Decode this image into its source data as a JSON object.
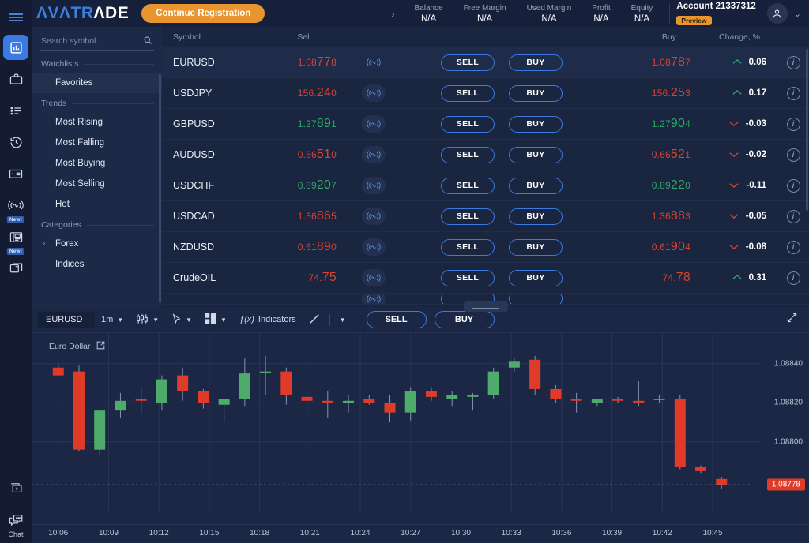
{
  "rail": {
    "menu_label": "menu",
    "items": [
      {
        "name": "trading",
        "icon": "chart-bars-icon",
        "active": true
      },
      {
        "name": "portfolio",
        "icon": "briefcase-icon",
        "active": false
      },
      {
        "name": "orders",
        "icon": "list-icon",
        "active": false
      },
      {
        "name": "history",
        "icon": "history-clock-icon",
        "active": false
      },
      {
        "name": "funds",
        "icon": "card-icon",
        "active": false
      },
      {
        "name": "signals",
        "icon": "signal-wave-icon",
        "active": false,
        "badge": "New!"
      },
      {
        "name": "news",
        "icon": "newspaper-icon",
        "active": false,
        "badge": "New!"
      },
      {
        "name": "windows",
        "icon": "window-icon",
        "active": false
      }
    ],
    "bottom": [
      {
        "name": "video",
        "icon": "video-play-icon"
      },
      {
        "name": "chat",
        "icon": "chat-bubble-icon",
        "label": "Chat"
      }
    ]
  },
  "header": {
    "logo_a": "ΛVΛTR",
    "logo_b": "ΛDE",
    "cta_label": "Continue Registration",
    "expand_chevron": "›",
    "metrics": [
      {
        "label": "Balance",
        "value": "N/A"
      },
      {
        "label": "Free Margin",
        "value": "N/A"
      },
      {
        "label": "Used Margin",
        "value": "N/A"
      },
      {
        "label": "Profit",
        "value": "N/A"
      },
      {
        "label": "Equity",
        "value": "N/A"
      }
    ],
    "account_name": "Account 21337312",
    "account_badge": "Preview",
    "dropdown_caret": "⌄"
  },
  "watchlist": {
    "search_placeholder": "Search symbol...",
    "groups": [
      {
        "title": "Watchlists",
        "items": [
          {
            "label": "Favorites",
            "selected": true
          }
        ]
      },
      {
        "title": "Trends",
        "items": [
          {
            "label": "Most Rising"
          },
          {
            "label": "Most Falling"
          },
          {
            "label": "Most Buying"
          },
          {
            "label": "Most Selling"
          },
          {
            "label": "Hot"
          }
        ]
      },
      {
        "title": "Categories",
        "items": [
          {
            "label": "Forex",
            "caret": "›"
          },
          {
            "label": "Indices"
          }
        ]
      }
    ]
  },
  "table": {
    "columns": {
      "symbol": "Symbol",
      "sell": "Sell",
      "buy": "Buy",
      "change": "Change, %"
    },
    "sell_label": "SELL",
    "buy_label": "BUY",
    "rows": [
      {
        "symbol": "EURUSD",
        "sell_pre": "1.08",
        "sell_big": "77",
        "sell_post": "8",
        "sell_dir": "dn",
        "buy_pre": "1.08",
        "buy_big": "78",
        "buy_post": "7",
        "buy_dir": "dn",
        "change": "0.06",
        "change_dir": "up",
        "highlight": true
      },
      {
        "symbol": "USDJPY",
        "sell_pre": "156.",
        "sell_big": "24",
        "sell_post": "0",
        "sell_dir": "dn",
        "buy_pre": "156.",
        "buy_big": "25",
        "buy_post": "3",
        "buy_dir": "dn",
        "change": "0.17",
        "change_dir": "up"
      },
      {
        "symbol": "GBPUSD",
        "sell_pre": "1.27",
        "sell_big": "89",
        "sell_post": "1",
        "sell_dir": "up",
        "buy_pre": "1.27",
        "buy_big": "90",
        "buy_post": "4",
        "buy_dir": "up",
        "change": "-0.03",
        "change_dir": "dn"
      },
      {
        "symbol": "AUDUSD",
        "sell_pre": "0.66",
        "sell_big": "51",
        "sell_post": "0",
        "sell_dir": "dn",
        "buy_pre": "0.66",
        "buy_big": "52",
        "buy_post": "1",
        "buy_dir": "dn",
        "change": "-0.02",
        "change_dir": "dn"
      },
      {
        "symbol": "USDCHF",
        "sell_pre": "0.89",
        "sell_big": "20",
        "sell_post": "7",
        "sell_dir": "up",
        "buy_pre": "0.89",
        "buy_big": "22",
        "buy_post": "0",
        "buy_dir": "up",
        "change": "-0.11",
        "change_dir": "dn"
      },
      {
        "symbol": "USDCAD",
        "sell_pre": "1.36",
        "sell_big": "86",
        "sell_post": "5",
        "sell_dir": "dn",
        "buy_pre": "1.36",
        "buy_big": "88",
        "buy_post": "3",
        "buy_dir": "dn",
        "change": "-0.05",
        "change_dir": "dn"
      },
      {
        "symbol": "NZDUSD",
        "sell_pre": "0.61",
        "sell_big": "89",
        "sell_post": "0",
        "sell_dir": "dn",
        "buy_pre": "0.61",
        "buy_big": "90",
        "buy_post": "4",
        "buy_dir": "dn",
        "change": "-0.08",
        "change_dir": "dn"
      },
      {
        "symbol": "CrudeOIL",
        "sell_pre": "74.",
        "sell_big": "75",
        "sell_post": "",
        "sell_dir": "dn",
        "buy_pre": "74.",
        "buy_big": "78",
        "buy_post": "",
        "buy_dir": "dn",
        "change": "0.31",
        "change_dir": "up"
      }
    ]
  },
  "chart_toolbar": {
    "symbol": "EURUSD",
    "timeframe": "1m",
    "chart_type_icon": "candlestick-icon",
    "cursor_icon": "cursor-arrow-icon",
    "layout_icon": "layout-grid-icon",
    "indicators_label": "Indicators",
    "indicators_prefix": "ƒ(x)",
    "drawing_icon": "trendline-icon",
    "sell_label": "SELL",
    "buy_label": "BUY",
    "expand_icon": "expand-diagonal-icon"
  },
  "chart_data": {
    "type": "candlestick",
    "title": "Euro Dollar",
    "symbol": "EURUSD",
    "timeframe": "1m",
    "xlabel": "",
    "ylabel": "",
    "grid": true,
    "ylim": [
      1.08768,
      1.0885
    ],
    "y_ticks": [
      "1.08840",
      "1.08820",
      "1.08800"
    ],
    "y_tick_values": [
      1.0884,
      1.0882,
      1.088
    ],
    "last_price": "1.08778",
    "last_price_value": 1.08778,
    "x_ticks": [
      "10:06",
      "10:09",
      "10:12",
      "10:15",
      "10:18",
      "10:21",
      "10:24",
      "10:27",
      "10:30",
      "10:33",
      "10:36",
      "10:39",
      "10:42",
      "10:45"
    ],
    "up_color": "#4fab6b",
    "down_color": "#e03b28",
    "candles": [
      {
        "o": 1.08838,
        "h": 1.0884,
        "l": 1.08834,
        "c": 1.08834
      },
      {
        "o": 1.08836,
        "h": 1.08839,
        "l": 1.08795,
        "c": 1.08796
      },
      {
        "o": 1.08796,
        "h": 1.08797,
        "l": 1.08793,
        "c": 1.08816
      },
      {
        "o": 1.08816,
        "h": 1.08825,
        "l": 1.08812,
        "c": 1.08821
      },
      {
        "o": 1.08822,
        "h": 1.08828,
        "l": 1.08814,
        "c": 1.08821
      },
      {
        "o": 1.0882,
        "h": 1.08834,
        "l": 1.08816,
        "c": 1.08832
      },
      {
        "o": 1.08834,
        "h": 1.08838,
        "l": 1.08821,
        "c": 1.08826
      },
      {
        "o": 1.08826,
        "h": 1.08827,
        "l": 1.08817,
        "c": 1.0882
      },
      {
        "o": 1.08819,
        "h": 1.08821,
        "l": 1.0881,
        "c": 1.08822
      },
      {
        "o": 1.08822,
        "h": 1.08843,
        "l": 1.08818,
        "c": 1.08835
      },
      {
        "o": 1.08836,
        "h": 1.08844,
        "l": 1.08824,
        "c": 1.08836
      },
      {
        "o": 1.08836,
        "h": 1.08838,
        "l": 1.08819,
        "c": 1.08824
      },
      {
        "o": 1.08823,
        "h": 1.08825,
        "l": 1.08814,
        "c": 1.08821
      },
      {
        "o": 1.08821,
        "h": 1.08826,
        "l": 1.08812,
        "c": 1.0882
      },
      {
        "o": 1.0882,
        "h": 1.08824,
        "l": 1.08815,
        "c": 1.08821
      },
      {
        "o": 1.08822,
        "h": 1.08824,
        "l": 1.08819,
        "c": 1.0882
      },
      {
        "o": 1.0882,
        "h": 1.08824,
        "l": 1.0881,
        "c": 1.08815
      },
      {
        "o": 1.08815,
        "h": 1.08828,
        "l": 1.08811,
        "c": 1.08826
      },
      {
        "o": 1.08826,
        "h": 1.08828,
        "l": 1.08821,
        "c": 1.08823
      },
      {
        "o": 1.08822,
        "h": 1.08826,
        "l": 1.08818,
        "c": 1.08824
      },
      {
        "o": 1.08823,
        "h": 1.08825,
        "l": 1.08816,
        "c": 1.08824
      },
      {
        "o": 1.08824,
        "h": 1.08838,
        "l": 1.08822,
        "c": 1.08836
      },
      {
        "o": 1.08838,
        "h": 1.08843,
        "l": 1.08836,
        "c": 1.08841
      },
      {
        "o": 1.08842,
        "h": 1.08844,
        "l": 1.08824,
        "c": 1.08827
      },
      {
        "o": 1.08827,
        "h": 1.08829,
        "l": 1.0882,
        "c": 1.08822
      },
      {
        "o": 1.08822,
        "h": 1.08825,
        "l": 1.08815,
        "c": 1.08821
      },
      {
        "o": 1.0882,
        "h": 1.08822,
        "l": 1.08818,
        "c": 1.08822
      },
      {
        "o": 1.08822,
        "h": 1.08823,
        "l": 1.0882,
        "c": 1.08821
      },
      {
        "o": 1.08821,
        "h": 1.08831,
        "l": 1.08818,
        "c": 1.0882
      },
      {
        "o": 1.08822,
        "h": 1.08824,
        "l": 1.0882,
        "c": 1.08822
      },
      {
        "o": 1.08822,
        "h": 1.08824,
        "l": 1.08786,
        "c": 1.08787
      },
      {
        "o": 1.08787,
        "h": 1.08788,
        "l": 1.08784,
        "c": 1.08785
      },
      {
        "o": 1.08781,
        "h": 1.08782,
        "l": 1.08776,
        "c": 1.08778
      }
    ]
  }
}
